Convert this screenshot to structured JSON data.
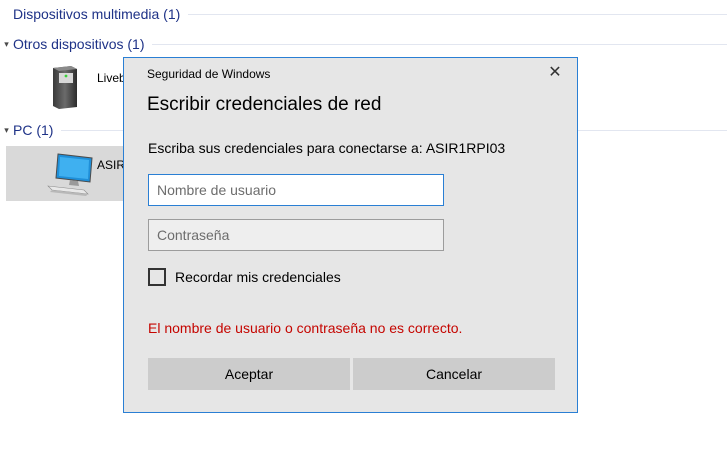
{
  "explorer": {
    "groups": [
      {
        "label": "Dispositivos multimedia (1)",
        "expanded": false
      },
      {
        "label": "Otros dispositivos (1)",
        "expanded": true
      },
      {
        "label": "PC (1)",
        "expanded": true
      }
    ],
    "other_device_label": "Liveb",
    "pc_device_label": "ASIR"
  },
  "dialog": {
    "window_title": "Seguridad de Windows",
    "close_glyph": "✕",
    "heading": "Escribir credenciales de red",
    "prompt": "Escriba sus credenciales para conectarse a: ASIR1RPI03",
    "username_placeholder": "Nombre de usuario",
    "username_value": "",
    "password_placeholder": "Contraseña",
    "password_value": "",
    "remember_label": "Recordar mis credenciales",
    "remember_checked": false,
    "error_message": "El nombre de usuario o contraseña no es correcto.",
    "ok_label": "Aceptar",
    "cancel_label": "Cancelar"
  },
  "colors": {
    "accent": "#2a7fd4",
    "error": "#c50500",
    "group_header": "#1e3287",
    "dialog_bg": "#e6e6e6",
    "button_bg": "#cccccc"
  },
  "icons": {
    "other_device": "server-tower-icon",
    "pc_device": "computer-monitor-icon",
    "group_chevron": "chevron-down-icon"
  }
}
